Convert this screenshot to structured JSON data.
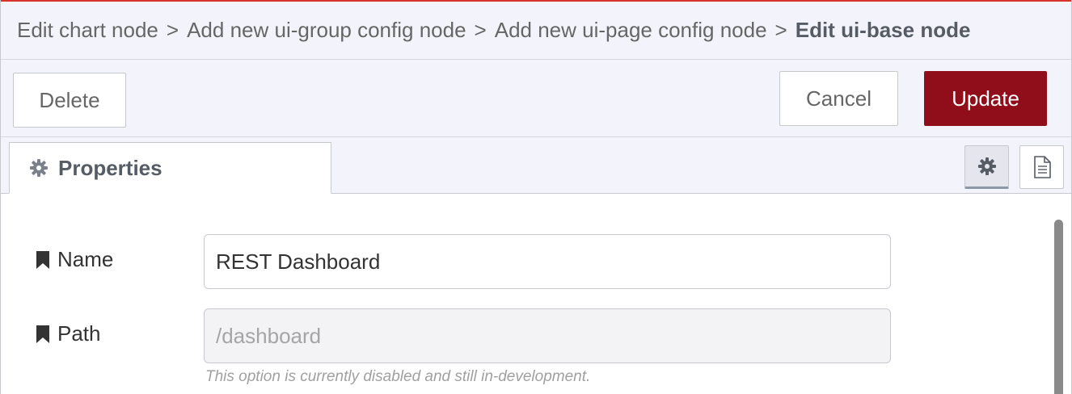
{
  "breadcrumb": {
    "items": [
      "Edit chart node",
      "Add new ui-group config node",
      "Add new ui-page config node"
    ],
    "separator": ">",
    "current": "Edit ui-base node"
  },
  "toolbar": {
    "delete_label": "Delete",
    "cancel_label": "Cancel",
    "update_label": "Update"
  },
  "tabs": {
    "properties_label": "Properties",
    "properties_icon": "gear-icon",
    "settings_icon": "gear-icon",
    "description_icon": "document-icon"
  },
  "form": {
    "name": {
      "label": "Name",
      "icon": "bookmark-icon",
      "value": "REST Dashboard"
    },
    "path": {
      "label": "Path",
      "icon": "bookmark-icon",
      "placeholder": "/dashboard",
      "value": "",
      "hint": "This option is currently disabled and still in-development."
    }
  },
  "colors": {
    "accent_top_line": "#d9322c",
    "update_button": "#8f0e1a",
    "tray_background": "#f3f3fb"
  }
}
